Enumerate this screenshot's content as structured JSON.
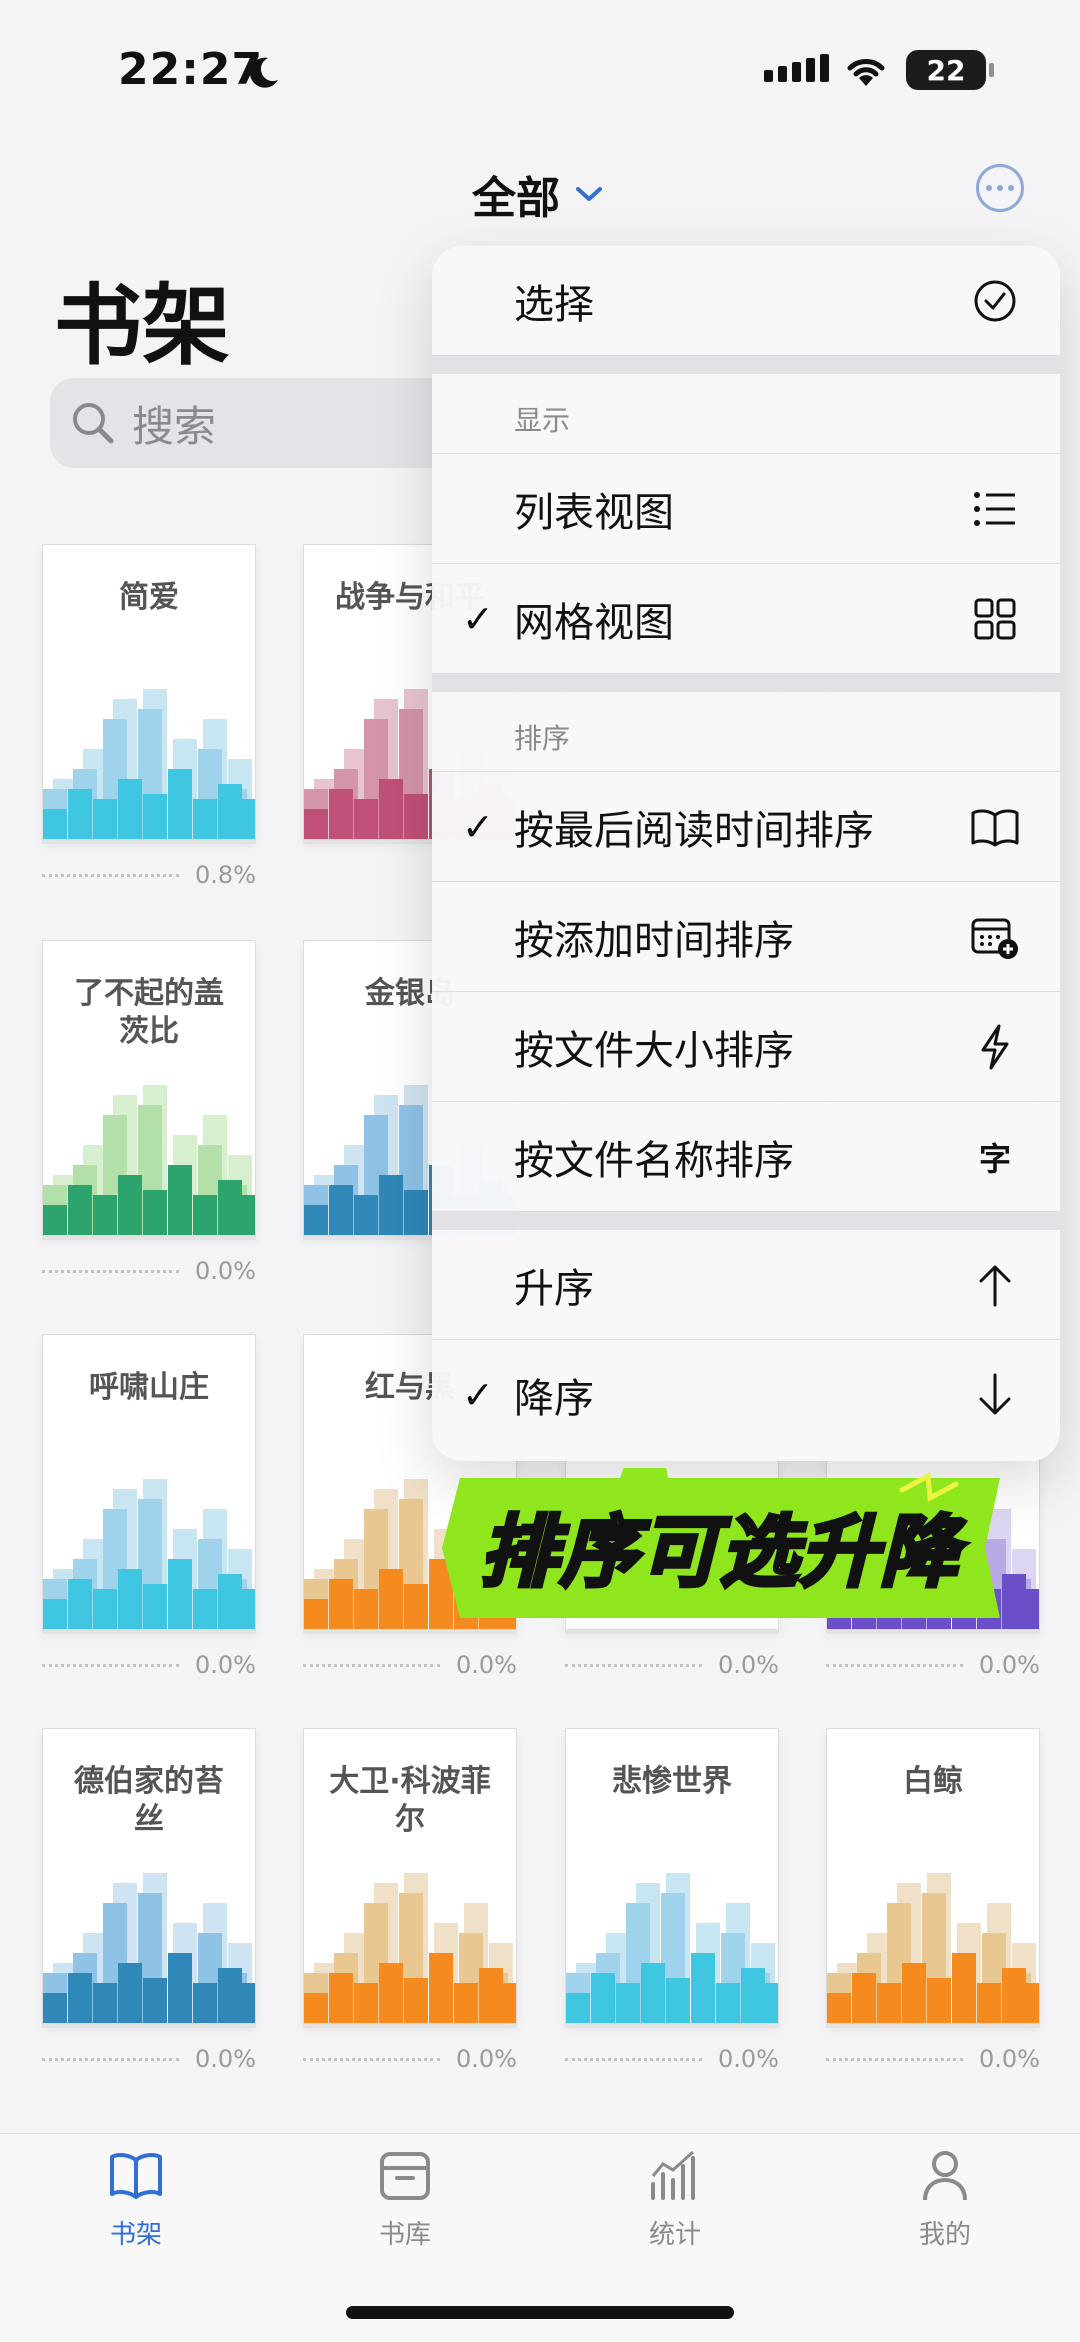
{
  "status": {
    "time": "22:27",
    "battery": "22"
  },
  "header": {
    "filter_label": "全部",
    "title": "书架",
    "search_placeholder": "搜索"
  },
  "books": [
    {
      "title": "简爱",
      "progress": "0.8%",
      "palette": "cyan"
    },
    {
      "title": "战争与和平",
      "progress": "",
      "palette": "pink"
    },
    {
      "title": "",
      "progress": "",
      "palette": "none"
    },
    {
      "title": "",
      "progress": "",
      "palette": "none"
    },
    {
      "title": "了不起的盖茨比",
      "progress": "0.0%",
      "palette": "green"
    },
    {
      "title": "金银岛",
      "progress": "",
      "palette": "blue"
    },
    {
      "title": "",
      "progress": "",
      "palette": "none"
    },
    {
      "title": "",
      "progress": "",
      "palette": "none"
    },
    {
      "title": "呼啸山庄",
      "progress": "0.0%",
      "palette": "cyan"
    },
    {
      "title": "红与黑",
      "progress": "0.0%",
      "palette": "orange"
    },
    {
      "title": "",
      "progress": "0.0%",
      "palette": "none"
    },
    {
      "title": "",
      "progress": "0.0%",
      "palette": "purple"
    },
    {
      "title": "德伯家的苔丝",
      "progress": "0.0%",
      "palette": "blue"
    },
    {
      "title": "大卫·科波菲尔",
      "progress": "0.0%",
      "palette": "orange"
    },
    {
      "title": "悲惨世界",
      "progress": "0.0%",
      "palette": "cyan"
    },
    {
      "title": "白鲸",
      "progress": "0.0%",
      "palette": "orange"
    }
  ],
  "menu": {
    "select_label": "选择",
    "display_header": "显示",
    "list_view": "列表视图",
    "grid_view": "网格视图",
    "sort_header": "排序",
    "sort_last_read": "按最后阅读时间排序",
    "sort_added": "按添加时间排序",
    "sort_size": "按文件大小排序",
    "sort_name": "按文件名称排序",
    "ascending": "升序",
    "descending": "降序",
    "name_icon_glyph": "字",
    "check_mark": "✓"
  },
  "callout": {
    "text": "排序可选升降",
    "color": "#8fe61c"
  },
  "tabs": [
    {
      "label": "书架",
      "active": true
    },
    {
      "label": "书库",
      "active": false
    },
    {
      "label": "统计",
      "active": false
    },
    {
      "label": "我的",
      "active": false
    }
  ],
  "colors": {
    "accent": "#2f6fd6"
  }
}
